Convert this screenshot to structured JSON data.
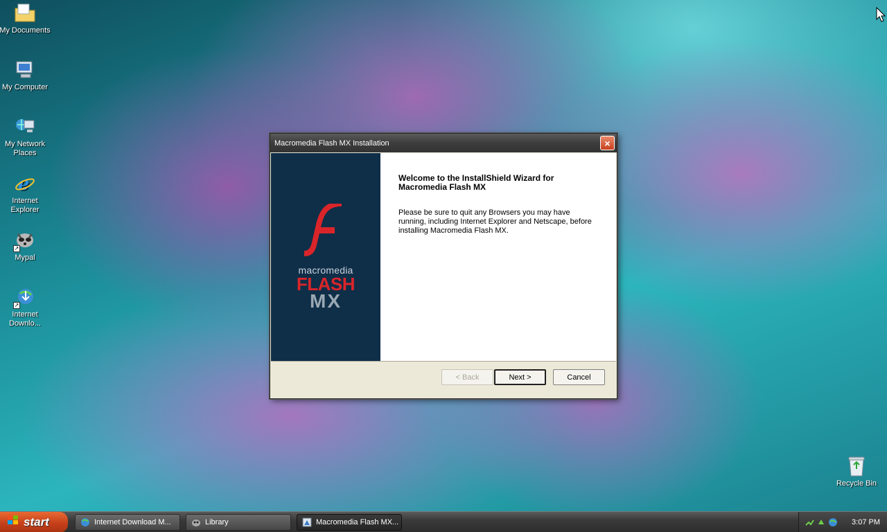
{
  "desktop": {
    "icons": [
      {
        "label": "My Documents"
      },
      {
        "label": "My Computer"
      },
      {
        "label": "My Network Places"
      },
      {
        "label": "Internet Explorer"
      },
      {
        "label": "Mypal"
      },
      {
        "label": "Internet Downlo..."
      },
      {
        "label": "Recycle Bin"
      }
    ]
  },
  "dialog": {
    "title": "Macromedia Flash MX Installation",
    "close_label": "×",
    "brand": {
      "word": "macromedia",
      "flash": "FLASH",
      "mx": "MX"
    },
    "heading": "Welcome to the InstallShield Wizard for Macromedia Flash MX",
    "body": "Please be sure to quit any Browsers you may have running, including Internet Explorer and Netscape, before installing Macromedia Flash MX.",
    "buttons": {
      "back": "< Back",
      "next": "Next >",
      "cancel": "Cancel"
    }
  },
  "taskbar": {
    "start_label": "start",
    "tasks": [
      {
        "label": "Internet Download M...",
        "active": false
      },
      {
        "label": "Library",
        "active": false
      },
      {
        "label": "Macromedia Flash MX...",
        "active": true
      }
    ],
    "clock": "3:07 PM"
  },
  "colors": {
    "start": "#c6401a",
    "flash_red": "#d9252a",
    "side_panel": "#0f2e48"
  }
}
